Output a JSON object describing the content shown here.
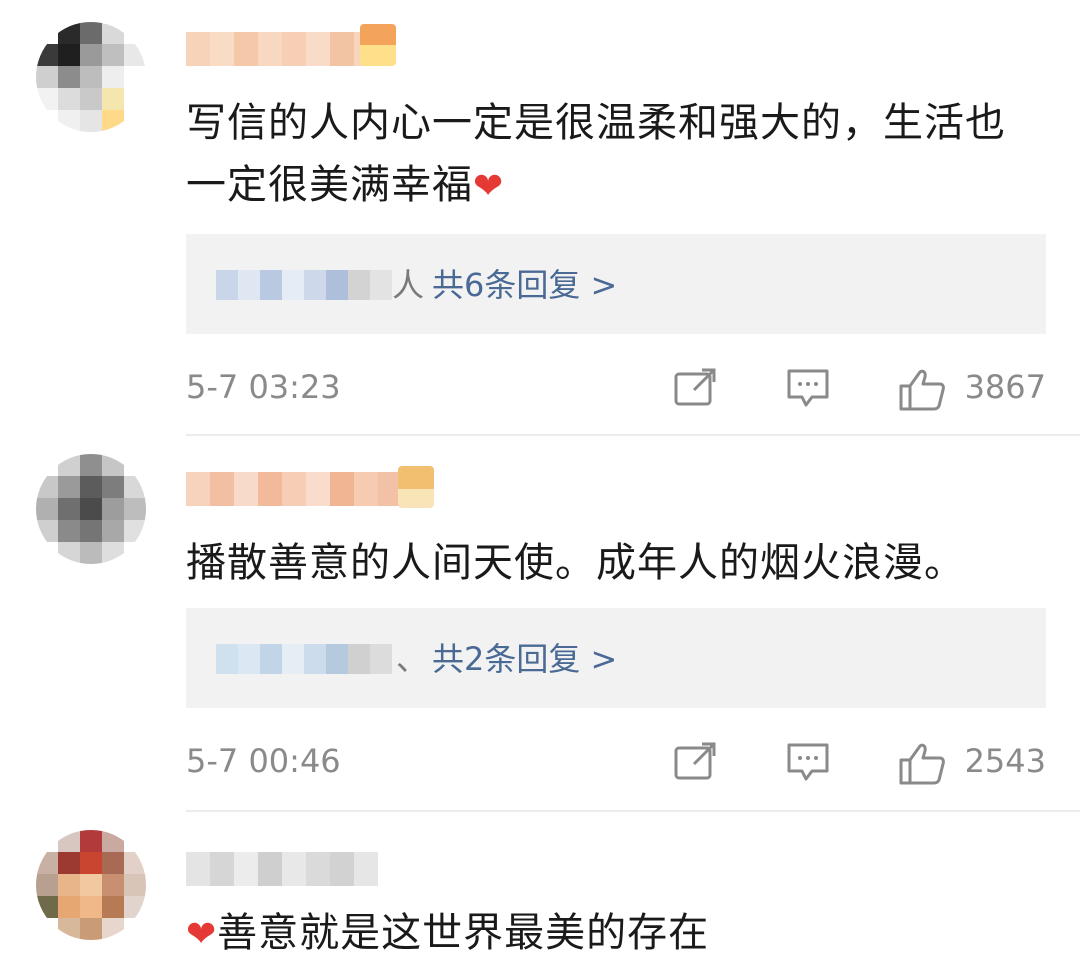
{
  "comments": [
    {
      "text": "写信的人内心一定是很温柔和强大的，生活也一定很美满幸福",
      "emoji": "❤",
      "reply_tail": "人",
      "reply_link": "共6条回复 >",
      "time": "5-7 03:23",
      "likes": "3867"
    },
    {
      "text": "播散善意的人间天使。成年人的烟火浪漫。",
      "emoji": "",
      "reply_tail": "、",
      "reply_link": "共2条回复 >",
      "time": "5-7 00:46",
      "likes": "2543"
    },
    {
      "text": "善意就是这世界最美的存在",
      "emoji": "❤"
    }
  ],
  "icons": {
    "repost": "repost-icon",
    "comment": "comment-icon",
    "like": "thumbs-up-icon"
  },
  "colors": {
    "reply_link": "#4a6a95",
    "meta_text": "#8a8a8a",
    "reply_bg": "#f2f2f2",
    "heart": "#e53935"
  }
}
